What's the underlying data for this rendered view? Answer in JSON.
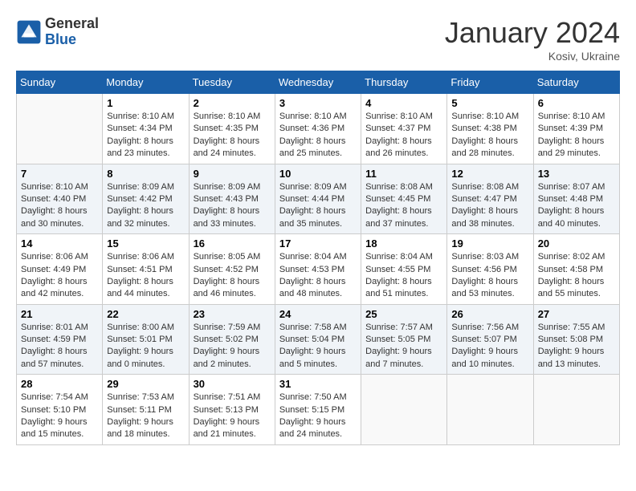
{
  "logo": {
    "text_general": "General",
    "text_blue": "Blue"
  },
  "title": "January 2024",
  "subtitle": "Kosiv, Ukraine",
  "days_of_week": [
    "Sunday",
    "Monday",
    "Tuesday",
    "Wednesday",
    "Thursday",
    "Friday",
    "Saturday"
  ],
  "weeks": [
    [
      {
        "day": "",
        "info": ""
      },
      {
        "day": "1",
        "info": "Sunrise: 8:10 AM\nSunset: 4:34 PM\nDaylight: 8 hours\nand 23 minutes."
      },
      {
        "day": "2",
        "info": "Sunrise: 8:10 AM\nSunset: 4:35 PM\nDaylight: 8 hours\nand 24 minutes."
      },
      {
        "day": "3",
        "info": "Sunrise: 8:10 AM\nSunset: 4:36 PM\nDaylight: 8 hours\nand 25 minutes."
      },
      {
        "day": "4",
        "info": "Sunrise: 8:10 AM\nSunset: 4:37 PM\nDaylight: 8 hours\nand 26 minutes."
      },
      {
        "day": "5",
        "info": "Sunrise: 8:10 AM\nSunset: 4:38 PM\nDaylight: 8 hours\nand 28 minutes."
      },
      {
        "day": "6",
        "info": "Sunrise: 8:10 AM\nSunset: 4:39 PM\nDaylight: 8 hours\nand 29 minutes."
      }
    ],
    [
      {
        "day": "7",
        "info": "Sunrise: 8:10 AM\nSunset: 4:40 PM\nDaylight: 8 hours\nand 30 minutes."
      },
      {
        "day": "8",
        "info": "Sunrise: 8:09 AM\nSunset: 4:42 PM\nDaylight: 8 hours\nand 32 minutes."
      },
      {
        "day": "9",
        "info": "Sunrise: 8:09 AM\nSunset: 4:43 PM\nDaylight: 8 hours\nand 33 minutes."
      },
      {
        "day": "10",
        "info": "Sunrise: 8:09 AM\nSunset: 4:44 PM\nDaylight: 8 hours\nand 35 minutes."
      },
      {
        "day": "11",
        "info": "Sunrise: 8:08 AM\nSunset: 4:45 PM\nDaylight: 8 hours\nand 37 minutes."
      },
      {
        "day": "12",
        "info": "Sunrise: 8:08 AM\nSunset: 4:47 PM\nDaylight: 8 hours\nand 38 minutes."
      },
      {
        "day": "13",
        "info": "Sunrise: 8:07 AM\nSunset: 4:48 PM\nDaylight: 8 hours\nand 40 minutes."
      }
    ],
    [
      {
        "day": "14",
        "info": "Sunrise: 8:06 AM\nSunset: 4:49 PM\nDaylight: 8 hours\nand 42 minutes."
      },
      {
        "day": "15",
        "info": "Sunrise: 8:06 AM\nSunset: 4:51 PM\nDaylight: 8 hours\nand 44 minutes."
      },
      {
        "day": "16",
        "info": "Sunrise: 8:05 AM\nSunset: 4:52 PM\nDaylight: 8 hours\nand 46 minutes."
      },
      {
        "day": "17",
        "info": "Sunrise: 8:04 AM\nSunset: 4:53 PM\nDaylight: 8 hours\nand 48 minutes."
      },
      {
        "day": "18",
        "info": "Sunrise: 8:04 AM\nSunset: 4:55 PM\nDaylight: 8 hours\nand 51 minutes."
      },
      {
        "day": "19",
        "info": "Sunrise: 8:03 AM\nSunset: 4:56 PM\nDaylight: 8 hours\nand 53 minutes."
      },
      {
        "day": "20",
        "info": "Sunrise: 8:02 AM\nSunset: 4:58 PM\nDaylight: 8 hours\nand 55 minutes."
      }
    ],
    [
      {
        "day": "21",
        "info": "Sunrise: 8:01 AM\nSunset: 4:59 PM\nDaylight: 8 hours\nand 57 minutes."
      },
      {
        "day": "22",
        "info": "Sunrise: 8:00 AM\nSunset: 5:01 PM\nDaylight: 9 hours\nand 0 minutes."
      },
      {
        "day": "23",
        "info": "Sunrise: 7:59 AM\nSunset: 5:02 PM\nDaylight: 9 hours\nand 2 minutes."
      },
      {
        "day": "24",
        "info": "Sunrise: 7:58 AM\nSunset: 5:04 PM\nDaylight: 9 hours\nand 5 minutes."
      },
      {
        "day": "25",
        "info": "Sunrise: 7:57 AM\nSunset: 5:05 PM\nDaylight: 9 hours\nand 7 minutes."
      },
      {
        "day": "26",
        "info": "Sunrise: 7:56 AM\nSunset: 5:07 PM\nDaylight: 9 hours\nand 10 minutes."
      },
      {
        "day": "27",
        "info": "Sunrise: 7:55 AM\nSunset: 5:08 PM\nDaylight: 9 hours\nand 13 minutes."
      }
    ],
    [
      {
        "day": "28",
        "info": "Sunrise: 7:54 AM\nSunset: 5:10 PM\nDaylight: 9 hours\nand 15 minutes."
      },
      {
        "day": "29",
        "info": "Sunrise: 7:53 AM\nSunset: 5:11 PM\nDaylight: 9 hours\nand 18 minutes."
      },
      {
        "day": "30",
        "info": "Sunrise: 7:51 AM\nSunset: 5:13 PM\nDaylight: 9 hours\nand 21 minutes."
      },
      {
        "day": "31",
        "info": "Sunrise: 7:50 AM\nSunset: 5:15 PM\nDaylight: 9 hours\nand 24 minutes."
      },
      {
        "day": "",
        "info": ""
      },
      {
        "day": "",
        "info": ""
      },
      {
        "day": "",
        "info": ""
      }
    ]
  ]
}
